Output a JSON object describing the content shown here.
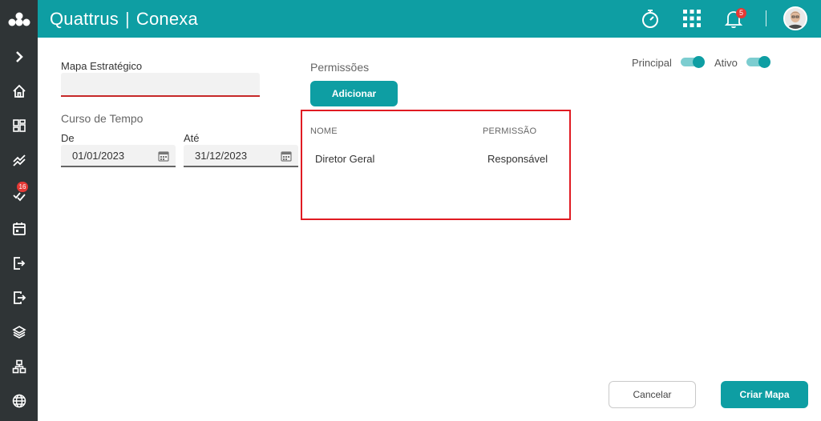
{
  "header": {
    "brand": "Quattrus",
    "separator": "|",
    "product": "Conexa",
    "notification_count": "5",
    "icons": [
      "logo-dots-icon",
      "timer-icon",
      "apps-grid-icon",
      "bell-icon",
      "avatar"
    ]
  },
  "sidebar": {
    "items": [
      {
        "icon": "chevron-right-icon"
      },
      {
        "icon": "home-icon"
      },
      {
        "icon": "dashboard-icon"
      },
      {
        "icon": "trend-icon"
      },
      {
        "icon": "tasks-icon",
        "badge": "16"
      },
      {
        "icon": "calendar-icon"
      },
      {
        "icon": "login-icon"
      },
      {
        "icon": "logout-icon"
      },
      {
        "icon": "layers-icon"
      },
      {
        "icon": "hierarchy-icon"
      },
      {
        "icon": "globe-icon"
      }
    ]
  },
  "form": {
    "map_label": "Mapa Estratégico",
    "map_value": "",
    "time_label": "Curso de Tempo",
    "from_label": "De",
    "from_value": "01/01/2023",
    "to_label": "Até",
    "to_value": "31/12/2023"
  },
  "permissions": {
    "title": "Permissões",
    "add_label": "Adicionar",
    "columns": [
      "NOME",
      "PERMISSÃO"
    ],
    "rows": [
      {
        "name": "Diretor Geral",
        "permission": "Responsável"
      }
    ]
  },
  "toggles": {
    "principal_label": "Principal",
    "principal_on": true,
    "ativo_label": "Ativo",
    "ativo_on": true
  },
  "actions": {
    "cancel_label": "Cancelar",
    "create_label": "Criar Mapa"
  },
  "colors": {
    "accent": "#0e9ea3",
    "sidebar": "#2f3436",
    "highlight": "#e01b22",
    "badge": "#e53935"
  }
}
